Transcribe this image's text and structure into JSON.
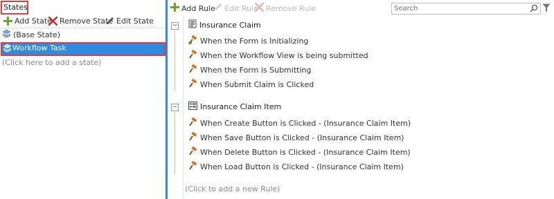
{
  "left_panel": {
    "title": "States",
    "toolbar": {
      "add_state": "Add State",
      "remove_state": "Remove State",
      "edit_state": "Edit State"
    },
    "states": [
      {
        "label": "(Base State)",
        "icon": "layers-icon"
      },
      {
        "label": "Workflow Task",
        "icon": "layers-icon",
        "selected": true
      }
    ],
    "add_hint": "(Click here to add a state)"
  },
  "right_panel": {
    "toolbar": {
      "add_rule": "Add Rule",
      "edit_rule": "Edit Rule",
      "remove_rule": "Remove Rule",
      "search_placeholder": "Search"
    },
    "groups": [
      {
        "title": "Insurance Claim",
        "icon": "form-icon",
        "rules": [
          "When the Form is Initializing",
          "When the Workflow View is being submitted",
          "When the Form is Submitting",
          "When Submit Claim is Clicked"
        ]
      },
      {
        "title": "Insurance Claim Item",
        "icon": "view-icon",
        "rules": [
          "When Create Button is Clicked - (Insurance Claim Item)",
          "When Save Button is Clicked - (Insurance Claim Item)",
          "When Delete Button is Clicked - (Insurance Claim Item)",
          "When Load Button is Clicked - (Insurance Claim Item)"
        ]
      }
    ],
    "add_hint": "(Click to add a new Rule)"
  },
  "colors": {
    "accent": "#2f8be0",
    "highlight_border": "#e53b3b",
    "add_green": "#6aa82c",
    "remove_red": "#c0302b",
    "disabled": "#bdbdbd"
  }
}
